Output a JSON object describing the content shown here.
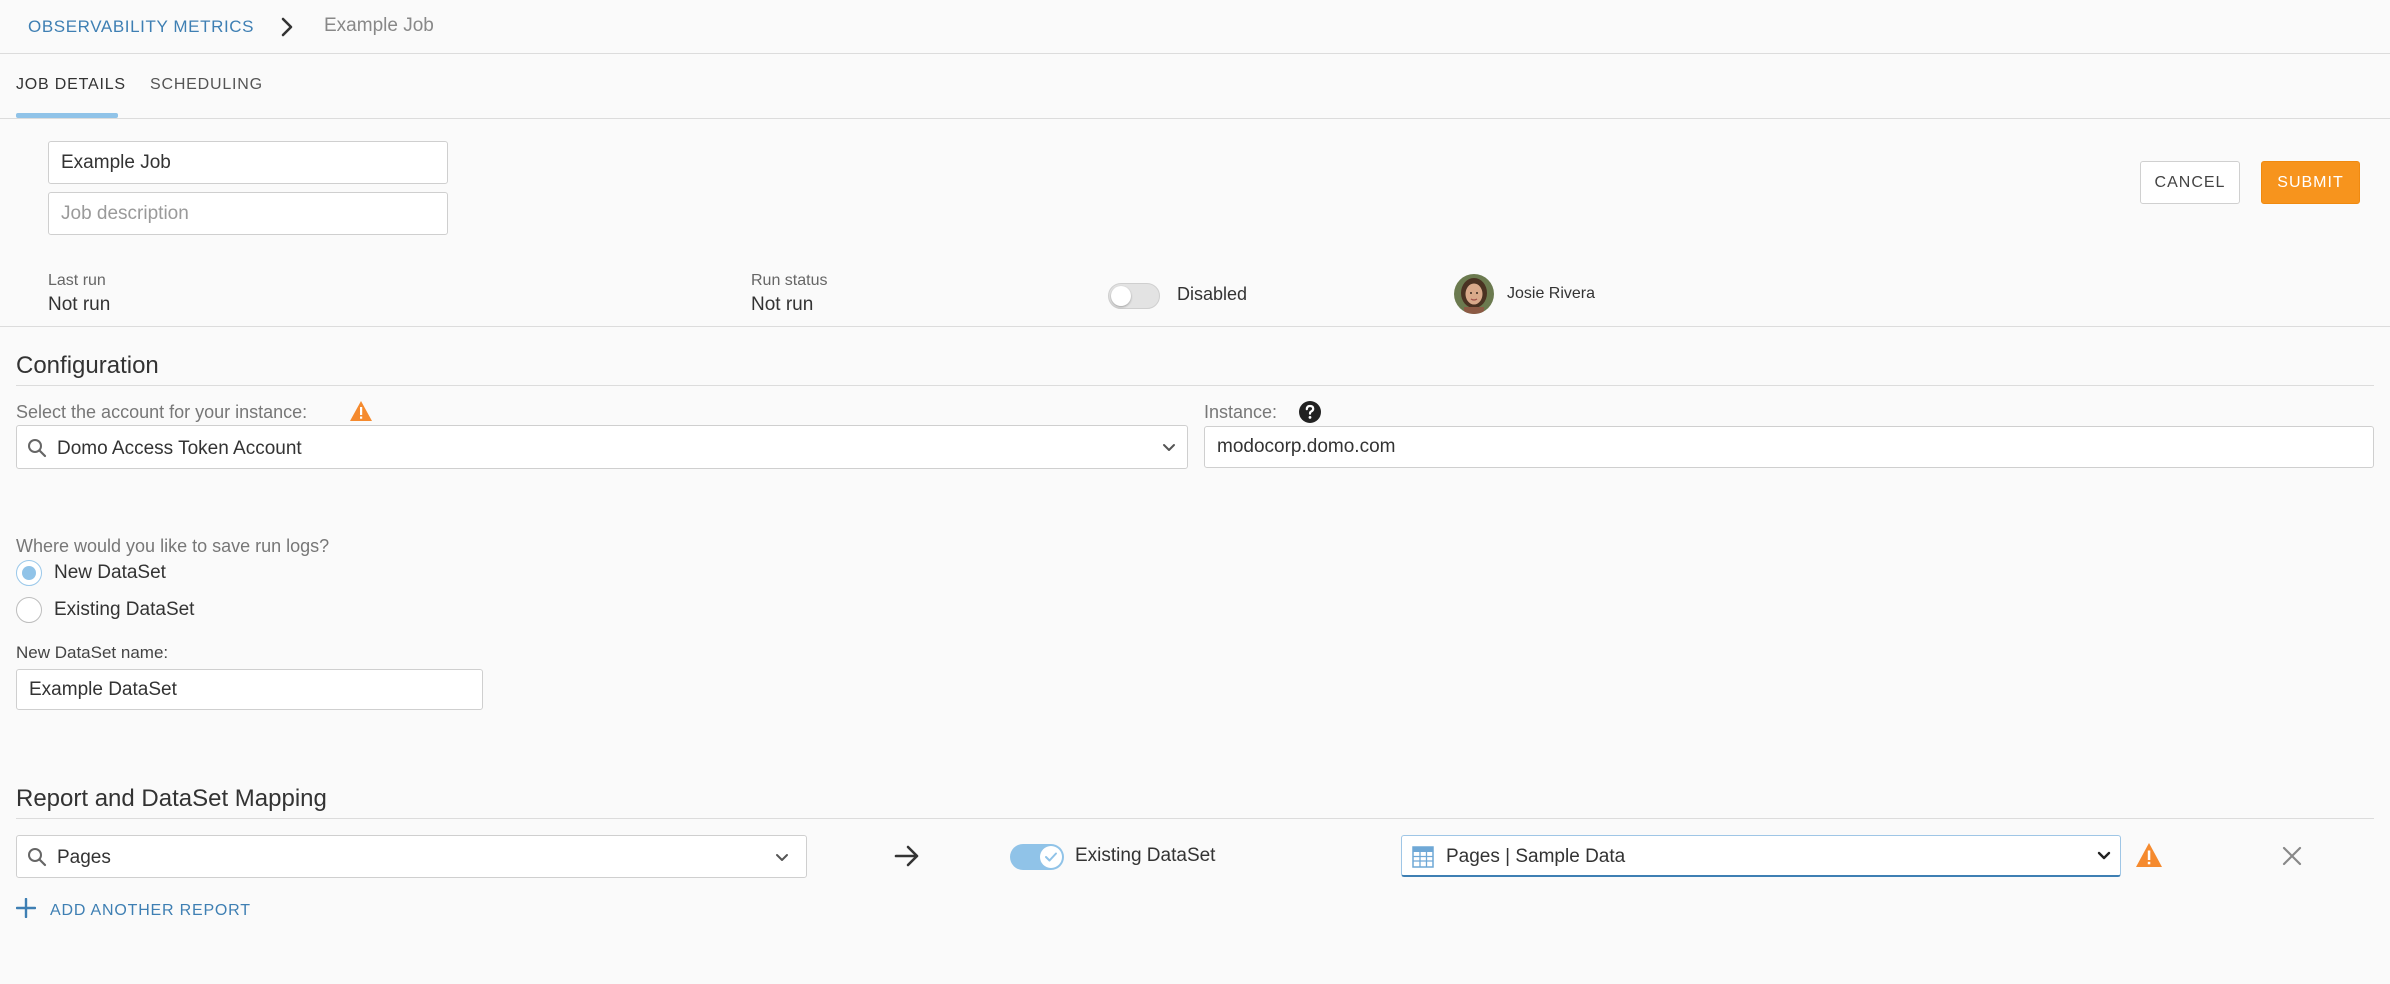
{
  "breadcrumb": {
    "root": "OBSERVABILITY METRICS",
    "current": "Example Job"
  },
  "tabs": [
    {
      "label": "JOB DETAILS",
      "active": true
    },
    {
      "label": "SCHEDULING",
      "active": false
    }
  ],
  "job": {
    "name": "Example Job",
    "description_placeholder": "Job description"
  },
  "actions": {
    "cancel_label": "CANCEL",
    "submit_label": "SUBMIT",
    "submit_color": "#f7941d"
  },
  "meta": {
    "last_run_label": "Last run",
    "last_run_value": "Not run",
    "run_status_label": "Run status",
    "run_status_value": "Not run",
    "enabled_toggle_label": "Disabled",
    "enabled": false,
    "owner_name": "Josie Rivera"
  },
  "configuration": {
    "title": "Configuration",
    "account_label": "Select the account for your instance:",
    "account_value": "Domo Access Token Account",
    "instance_label": "Instance:",
    "instance_value": "modocorp.domo.com",
    "logs_question": "Where would you like to save run logs?",
    "log_options": [
      {
        "label": "New DataSet",
        "selected": true
      },
      {
        "label": "Existing DataSet",
        "selected": false
      }
    ],
    "new_dataset_label": "New DataSet name:",
    "new_dataset_value": "Example DataSet"
  },
  "mapping": {
    "title": "Report and DataSet Mapping",
    "rows": [
      {
        "report": "Pages",
        "toggle_label": "Existing DataSet",
        "toggle_on": true,
        "dataset": "Pages | Sample Data"
      }
    ],
    "add_label": "ADD ANOTHER REPORT"
  },
  "colors": {
    "accent_blue": "#3e7fb3",
    "toggle_blue": "#90c3e8",
    "warning_orange": "#f58a2e"
  }
}
